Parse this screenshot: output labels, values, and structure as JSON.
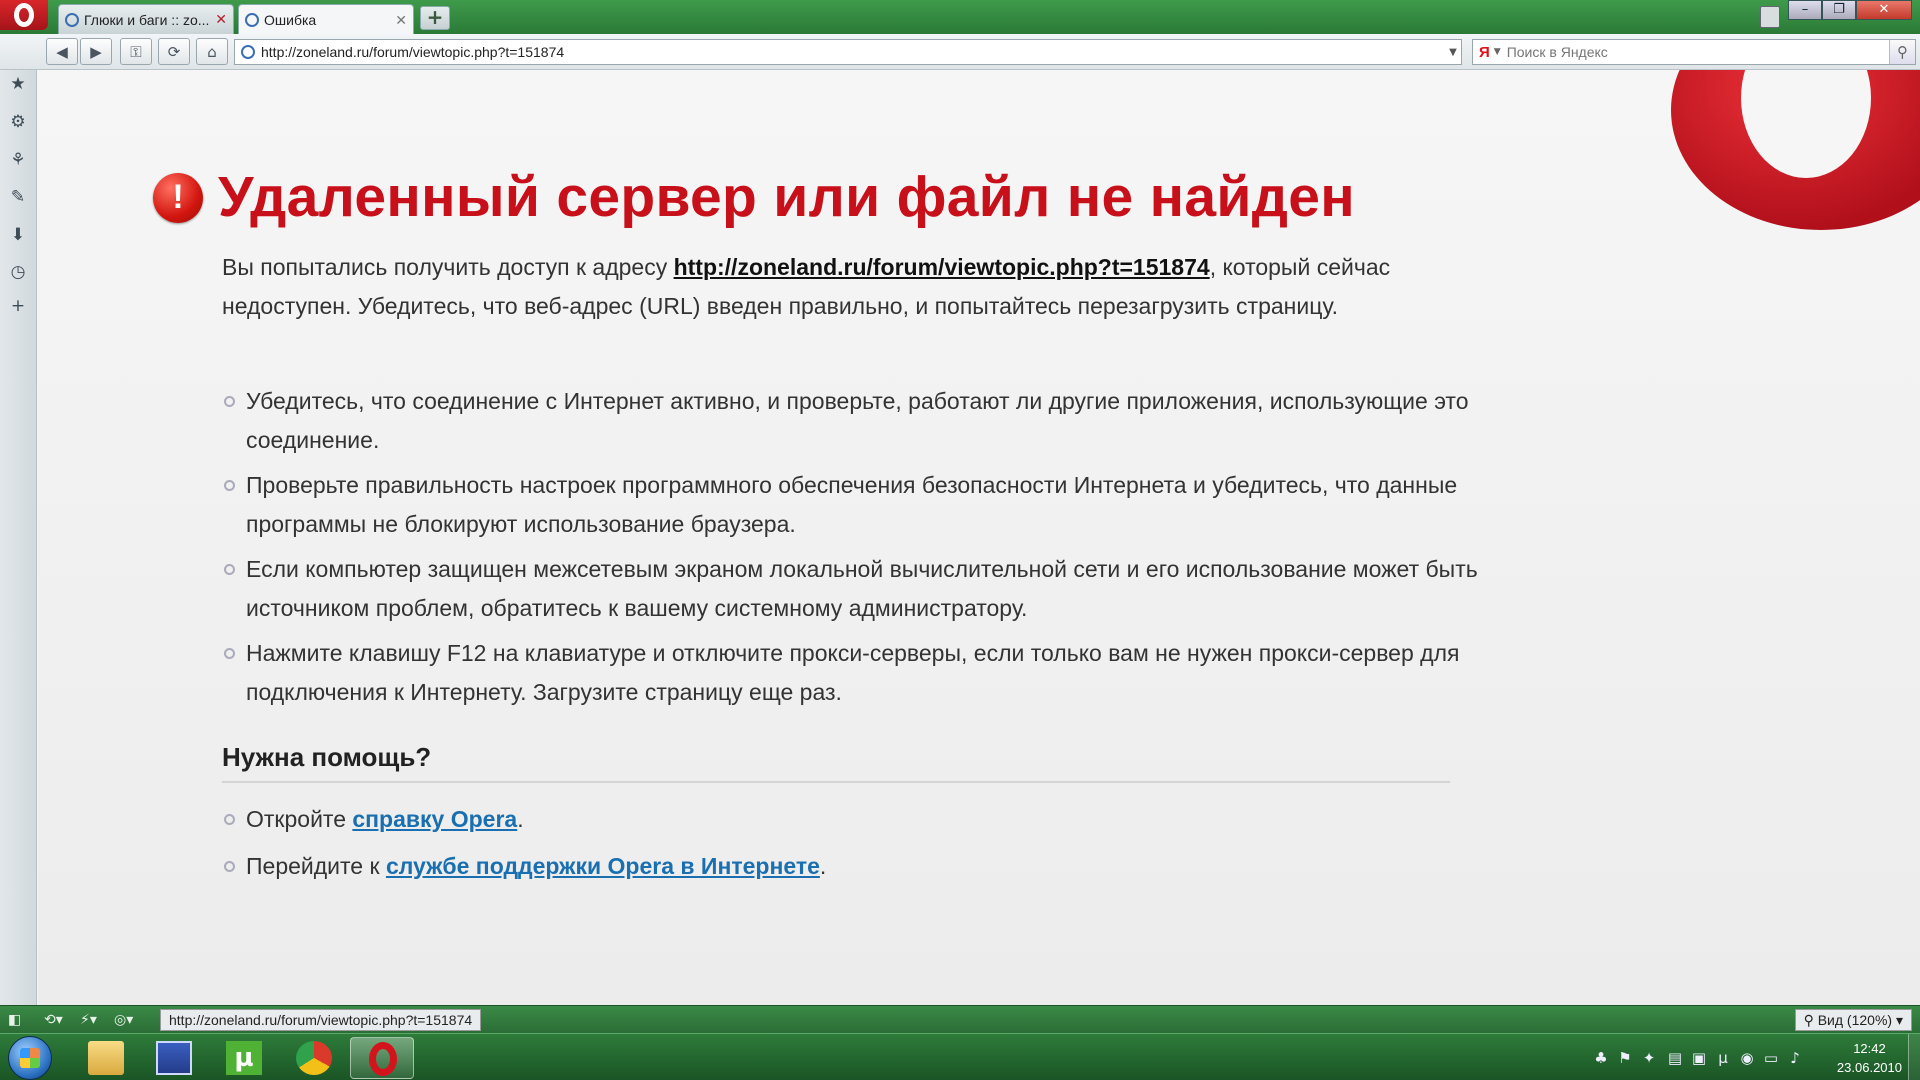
{
  "tabs": [
    {
      "label": "Глюки и баги :: zo...",
      "active": false
    },
    {
      "label": "Ошибка",
      "active": true
    }
  ],
  "toolbar": {
    "address": "http://zoneland.ru/forum/viewtopic.php?t=151874",
    "search_engine_glyph": "Я",
    "search_placeholder": "Поиск в Яндекс"
  },
  "error_page": {
    "title": "Удаленный сервер или файл не найден",
    "intro_before": "Вы попытались получить доступ к адресу ",
    "intro_link": "http://zoneland.ru/forum/viewtopic.php?t=151874",
    "intro_after": ", который сейчас недоступен. Убедитесь, что веб-адрес (URL) введен правильно, и попытайтесь перезагрузить страницу.",
    "tips": [
      "Убедитесь, что соединение с Интернет активно, и проверьте, работают ли другие приложения, использующие это соединение.",
      "Проверьте правильность настроек программного обеспечения безопасности Интернета и убедитесь, что данные программы не блокируют использование браузера.",
      "Если компьютер защищен межсетевым экраном локальной вычислительной сети и его использование может быть источником проблем, обратитесь к вашему системному администратору.",
      "Нажмите клавишу F12 на клавиатуре и отключите прокси-серверы, если только вам не нужен прокси-сервер для подключения к Интернету. Загрузите страницу еще раз."
    ],
    "help_title": "Нужна помощь?",
    "help": [
      {
        "before": "Откройте ",
        "link": "справку Opera",
        "after": "."
      },
      {
        "before": "Перейдите к ",
        "link": "службе поддержки Opera в Интернете",
        "after": "."
      }
    ]
  },
  "statusbar": {
    "url": "http://zoneland.ru/forum/viewtopic.php?t=151874",
    "zoom": "Вид (120%)"
  },
  "taskbar": {
    "time": "12:42",
    "date": "23.06.2010"
  },
  "colors": {
    "title_red": "#c8101a",
    "link_blue": "#1a6fb0",
    "chrome_green": "#2a7a36"
  }
}
